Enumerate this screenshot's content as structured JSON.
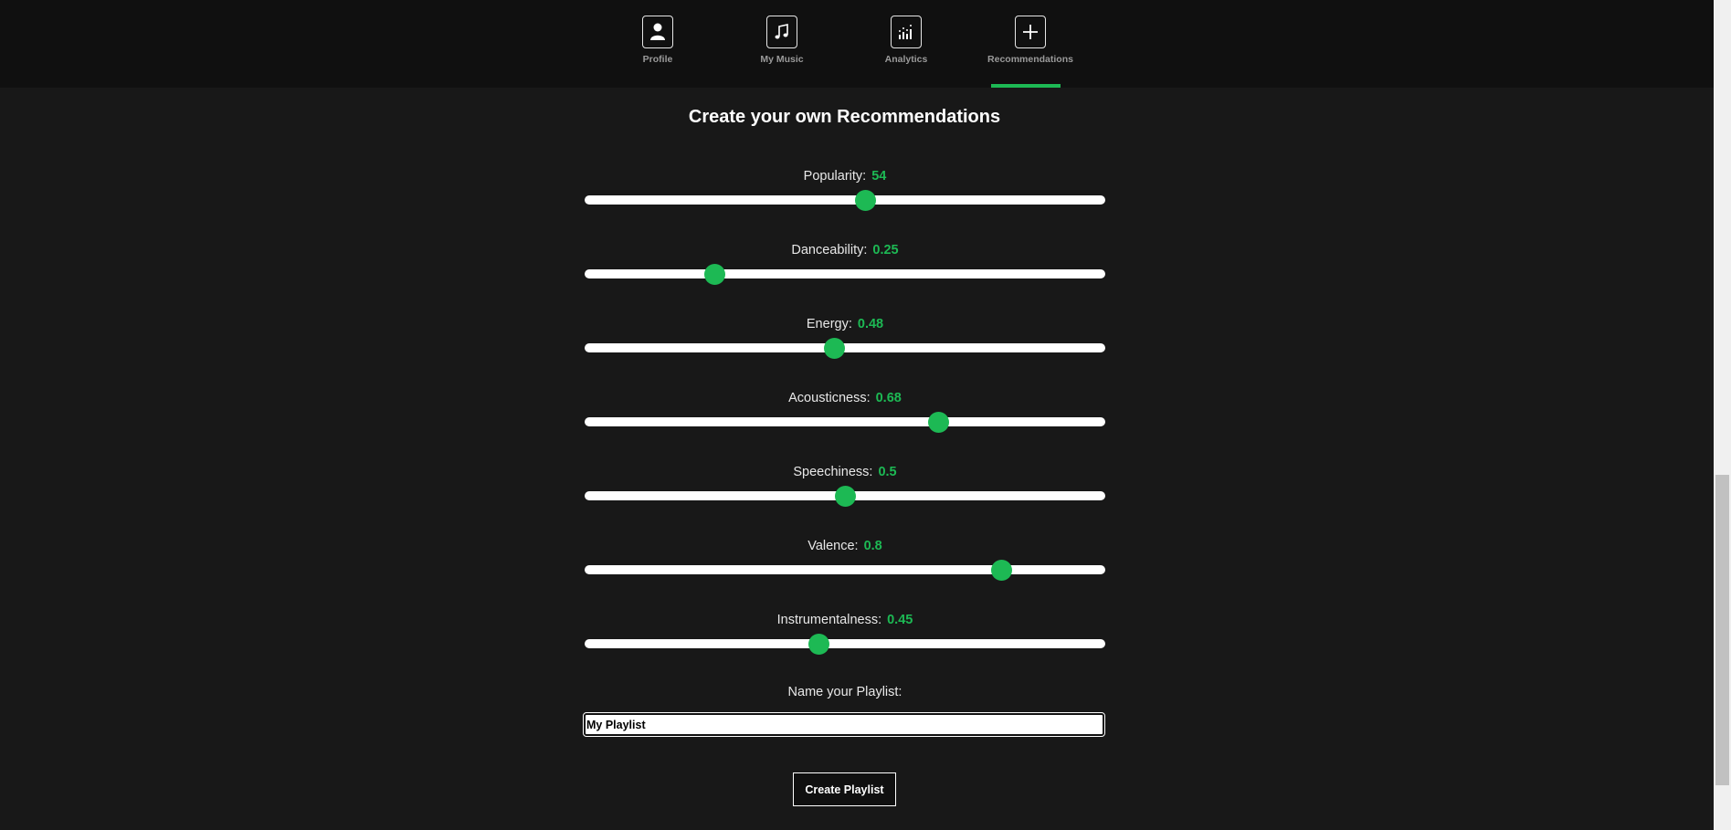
{
  "nav": {
    "items": [
      {
        "label": "Profile",
        "icon": "person-icon"
      },
      {
        "label": "My Music",
        "icon": "music-note-icon"
      },
      {
        "label": "Analytics",
        "icon": "bar-chart-icon"
      },
      {
        "label": "Recommendations",
        "icon": "plus-icon"
      }
    ],
    "active": "Recommendations",
    "accent_color": "#1db954"
  },
  "main": {
    "title": "Create your own Recommendations",
    "sliders": [
      {
        "label": "Popularity:",
        "value": "54",
        "fraction": 0.54
      },
      {
        "label": "Danceability:",
        "value": "0.25",
        "fraction": 0.25
      },
      {
        "label": "Energy:",
        "value": "0.48",
        "fraction": 0.48
      },
      {
        "label": "Acousticness:",
        "value": "0.68",
        "fraction": 0.68
      },
      {
        "label": "Speechiness:",
        "value": "0.5",
        "fraction": 0.5
      },
      {
        "label": "Valence:",
        "value": "0.8",
        "fraction": 0.8
      },
      {
        "label": "Instrumentalness:",
        "value": "0.45",
        "fraction": 0.45
      }
    ],
    "playlist_name_label": "Name your Playlist:",
    "playlist_name_value": "My Playlist",
    "create_button_label": "Create Playlist"
  }
}
